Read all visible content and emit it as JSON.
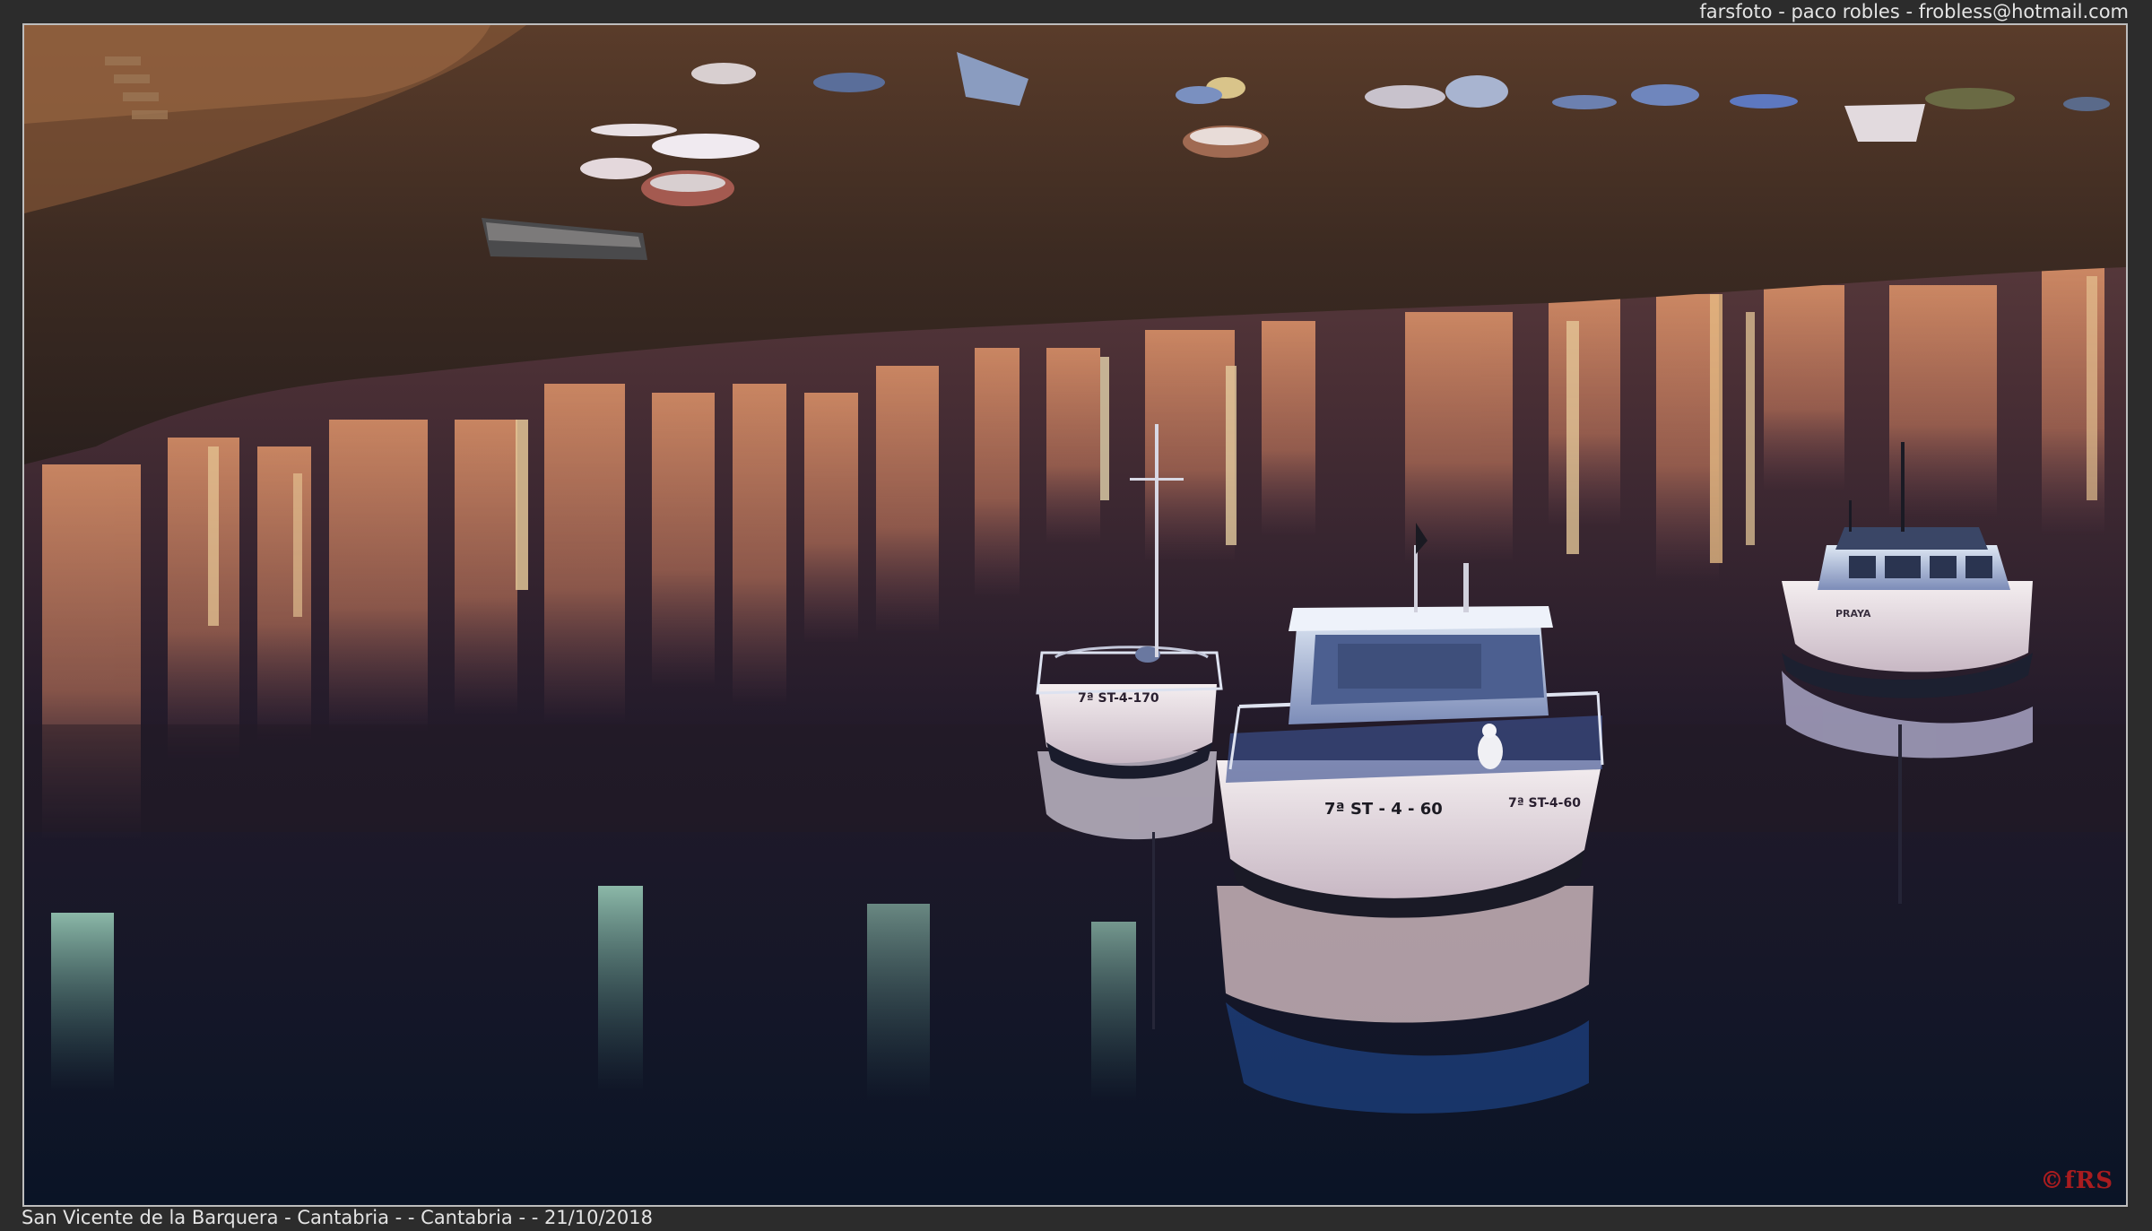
{
  "credit": "farsfoto - paco robles - frobless@hotmail.com",
  "caption": "San Vicente de la Barquera - Cantabria - - Cantabria - - 21/10/2018",
  "watermark": "©fRS",
  "hull_numbers": {
    "left_boat": "7ª ST-4-170",
    "center_boat": "7ª ST - 4 - 60",
    "center_boat_side": "7ª ST-4-60",
    "right_boat": "PRAYA"
  }
}
